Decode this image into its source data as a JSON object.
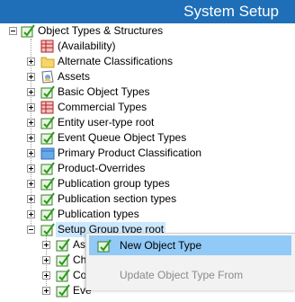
{
  "window": {
    "title": "System Setup"
  },
  "tree": {
    "root": {
      "label": "Object Types & Structures",
      "icon": "object-type-icon"
    },
    "items": [
      {
        "label": "(Availability)",
        "icon": "table-icon",
        "expander": "none"
      },
      {
        "label": "Alternate Classifications",
        "icon": "folder-icon",
        "expander": "plus"
      },
      {
        "label": "Assets",
        "icon": "asset-icon",
        "expander": "plus"
      },
      {
        "label": "Basic Object Types",
        "icon": "object-type-icon",
        "expander": "plus"
      },
      {
        "label": "Commercial Types",
        "icon": "table-icon",
        "expander": "plus"
      },
      {
        "label": "Entity user-type root",
        "icon": "object-type-icon",
        "expander": "plus"
      },
      {
        "label": "Event Queue Object Types",
        "icon": "object-type-icon",
        "expander": "plus"
      },
      {
        "label": "Primary Product Classification",
        "icon": "classification-icon",
        "expander": "plus"
      },
      {
        "label": "Product-Overrides",
        "icon": "object-type-icon",
        "expander": "plus"
      },
      {
        "label": "Publication group types",
        "icon": "object-type-icon",
        "expander": "plus"
      },
      {
        "label": "Publication section types",
        "icon": "object-type-icon",
        "expander": "plus"
      },
      {
        "label": "Publication types",
        "icon": "object-type-icon",
        "expander": "plus"
      },
      {
        "label": "Setup Group type root",
        "icon": "object-type-icon",
        "expander": "minus",
        "selected": true
      }
    ],
    "children": [
      {
        "label": "Ass",
        "icon": "object-type-icon"
      },
      {
        "label": "Cha",
        "icon": "object-type-icon"
      },
      {
        "label": "Cor",
        "icon": "object-type-icon"
      },
      {
        "label": "Eve",
        "icon": "object-type-icon"
      }
    ]
  },
  "context_menu": {
    "items": [
      {
        "label": "New Object Type",
        "icon": "object-type-icon",
        "state": "hover"
      },
      {
        "label": "Update Object Type From",
        "state": "disabled"
      }
    ]
  },
  "colors": {
    "titlebar": "#1f6fb8",
    "selection": "#cce8ff",
    "menu_hover": "#91c9f7"
  }
}
